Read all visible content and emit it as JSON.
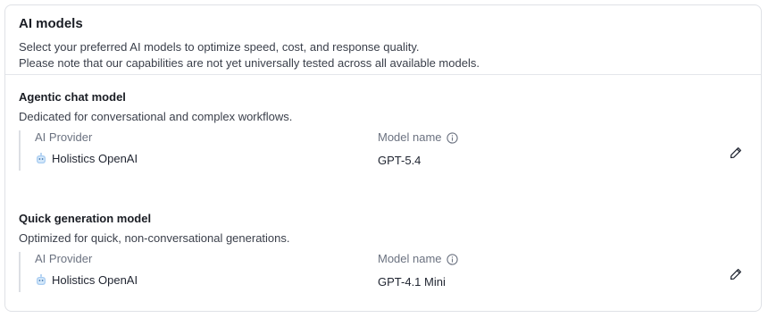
{
  "header": {
    "title": "AI models",
    "desc_line1": "Select your preferred AI models to optimize speed, cost, and response quality.",
    "desc_line2": "Please note that our capabilities are not yet universally tested across all available models."
  },
  "sections": [
    {
      "title": "Agentic chat model",
      "description": "Dedicated for conversational and complex workflows.",
      "provider_label": "AI Provider",
      "provider_value": "Holistics OpenAI",
      "provider_icon": "bot-icon",
      "model_label": "Model name",
      "model_value": "GPT-5.4"
    },
    {
      "title": "Quick generation model",
      "description": "Optimized for quick, non-conversational generations.",
      "provider_label": "AI Provider",
      "provider_value": "Holistics OpenAI",
      "provider_icon": "bot-icon",
      "model_label": "Model name",
      "model_value": "GPT-4.1 Mini"
    }
  ],
  "colors": {
    "border": "#dfe1e6",
    "label": "#6b7280",
    "text": "#1f2430",
    "bot": "#7fb3e8"
  }
}
